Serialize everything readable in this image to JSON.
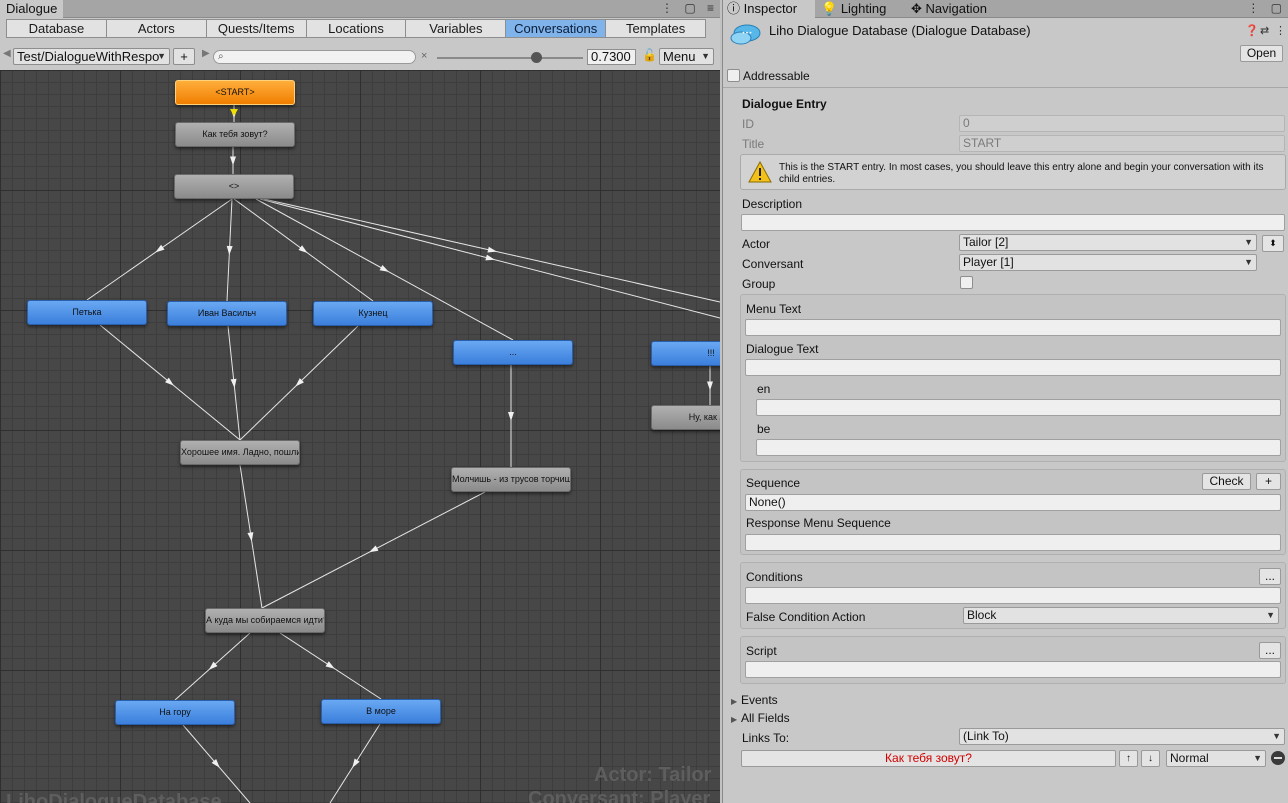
{
  "dialogue_window": {
    "tab_title": "Dialogue",
    "db_tabs": [
      {
        "label": "Database",
        "active": false
      },
      {
        "label": "Actors",
        "active": false
      },
      {
        "label": "Quests/Items",
        "active": false
      },
      {
        "label": "Locations",
        "active": false
      },
      {
        "label": "Variables",
        "active": false
      },
      {
        "label": "Conversations",
        "active": true
      },
      {
        "label": "Templates",
        "active": false
      }
    ],
    "toolbar": {
      "conversation_selected": "Test/DialogueWithRespo",
      "add_label": "+",
      "zoom": "0.7300",
      "zoom_fraction": 0.73,
      "menu_label": "Menu",
      "search_clear": "×"
    },
    "nodes": [
      {
        "id": "start",
        "text": "<START>",
        "kind": "start"
      },
      {
        "id": "ask",
        "text": "Как тебя зовут?",
        "kind": "npc"
      },
      {
        "id": "group",
        "text": "<>",
        "kind": "npc"
      },
      {
        "id": "petka",
        "text": "Петька",
        "kind": "pc"
      },
      {
        "id": "ivan",
        "text": "Иван Васильч",
        "kind": "pc"
      },
      {
        "id": "kuz",
        "text": "Кузнец",
        "kind": "pc"
      },
      {
        "id": "dots",
        "text": "...",
        "kind": "pc"
      },
      {
        "id": "bang",
        "text": "!!!",
        "kind": "pc"
      },
      {
        "id": "good",
        "text": "Хорошее имя. Ладно, пошли.",
        "kind": "npc"
      },
      {
        "id": "silent",
        "text": "Молчишь - из трусов торчиш",
        "kind": "npc"
      },
      {
        "id": "nu",
        "text": "Ну, как зов",
        "kind": "npc"
      },
      {
        "id": "where",
        "text": "А куда мы собираемся идти?",
        "kind": "npc"
      },
      {
        "id": "mount",
        "text": "На гору",
        "kind": "pc"
      },
      {
        "id": "sea",
        "text": "В море",
        "kind": "pc"
      }
    ],
    "watermark": {
      "actor": "Actor: Tailor",
      "conversant": "Conversant: Player",
      "database": "LihoDialogueDatabase"
    }
  },
  "inspector": {
    "tabs": [
      {
        "label": "Inspector",
        "icon": "info-icon"
      },
      {
        "label": "Lighting",
        "icon": "bulb-icon"
      },
      {
        "label": "Navigation",
        "icon": "compass-icon"
      }
    ],
    "title": "Liho Dialogue Database (Dialogue Database)",
    "open_button": "Open",
    "addressable_label": "Addressable",
    "section_title": "Dialogue Entry",
    "id_label": "ID",
    "id_value": "0",
    "title_label": "Title",
    "title_value": "START",
    "warning_text": "This is the START entry. In most cases, you should leave this entry alone and begin your conversation with its child entries.",
    "description_label": "Description",
    "description_value": "",
    "actor_label": "Actor",
    "actor_value": "Tailor [2]",
    "conversant_label": "Conversant",
    "conversant_value": "Player [1]",
    "group_label": "Group",
    "menu_text_label": "Menu Text",
    "menu_text_value": "",
    "dialogue_text_label": "Dialogue Text",
    "dialogue_text_value": "",
    "lang_en_label": "en",
    "lang_en_value": "",
    "lang_be_label": "be",
    "lang_be_value": "",
    "sequence_label": "Sequence",
    "check_button": "Check",
    "plus_button": "+",
    "sequence_value": "None()",
    "response_menu_label": "Response Menu Sequence",
    "response_menu_value": "",
    "conditions_label": "Conditions",
    "ellipsis": "...",
    "conditions_value": "",
    "false_condition_label": "False Condition Action",
    "false_condition_value": "Block",
    "script_label": "Script",
    "script_value": "",
    "events_label": "Events",
    "all_fields_label": "All Fields",
    "links_to_label": "Links To:",
    "links_to_value": "(Link To)",
    "link_entry": "Как тебя зовут?",
    "link_priority": "Normal",
    "link_entry_color": "#d10000"
  }
}
